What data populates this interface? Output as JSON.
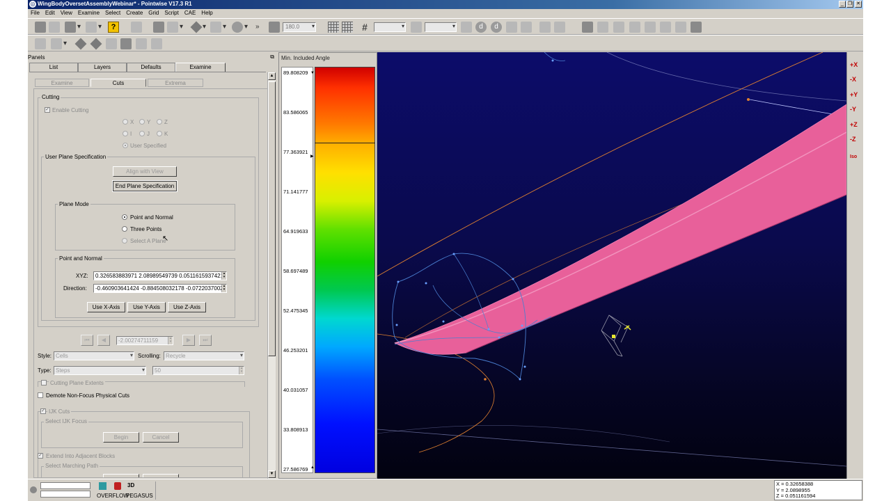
{
  "window": {
    "title": "WingBodyOversetAssemblyWebinar* - Pointwise V17.3 R1",
    "controls": [
      "_",
      "❐",
      "✕"
    ]
  },
  "menu": [
    "File",
    "Edit",
    "View",
    "Examine",
    "Select",
    "Create",
    "Grid",
    "Script",
    "CAE",
    "Help"
  ],
  "toolbar": {
    "angle_value": "180.0",
    "help_icon": "?",
    "more_glyph": "»"
  },
  "panels": {
    "header": "Panels",
    "float_glyph": "⧉",
    "tabs": [
      "List",
      "Layers",
      "Defaults",
      "Examine"
    ],
    "active_tab": "Examine",
    "subtabs": [
      "Examine",
      "Cuts",
      "Extrema"
    ],
    "active_subtab": "Cuts"
  },
  "cutting": {
    "group_title": "Cutting",
    "enable_cutting": "Enable Cutting",
    "axis_radios": [
      "X",
      "Y",
      "Z",
      "I",
      "J",
      "K"
    ],
    "user_specified": "User Specified",
    "user_plane_title": "User Plane Specification",
    "align_with_view": "Align with View",
    "end_plane_spec": "End Plane Specification",
    "plane_mode_title": "Plane Mode",
    "plane_modes": [
      "Point and Normal",
      "Three Points",
      "Select A Plane"
    ],
    "pn_title": "Point and Normal",
    "xyz_label": "XYZ:",
    "xyz_value": "0.326583883971 2.08989549739 0.0511615937421",
    "direction_label": "Direction:",
    "direction_value": "-0.460903641424 -0.884508032178 -0.0722037002",
    "use_x": "Use X-Axis",
    "use_y": "Use Y-Axis",
    "use_z": "Use Z-Axis",
    "nav_value": "-2.00274711159",
    "style_label": "Style:",
    "style_value": "Cells",
    "scrolling_label": "Scrolling:",
    "scrolling_value": "Recycle",
    "type_label": "Type:",
    "type_value": "Steps",
    "steps_value": "50",
    "cutting_plane_extents": "Cutting Plane Extents",
    "demote_label": "Demote Non-Focus Physical Cuts"
  },
  "ijk": {
    "group_title": "IJK Cuts",
    "select_focus_title": "Select IJK Focus",
    "begin": "Begin",
    "cancel": "Cancel",
    "extend_label": "Extend Into Adjacent Blocks",
    "marching_title": "Select Marching Path"
  },
  "colorbar": {
    "title": "Min. Included Angle",
    "ticks": [
      "89.808209",
      "83.586065",
      "77.363921",
      "71.141777",
      "64.919633",
      "58.697489",
      "52.475345",
      "46.253201",
      "40.031057",
      "33.808913",
      "27.586769"
    ],
    "marker_value": "77.363921"
  },
  "view_buttons": [
    "+X",
    "-X",
    "+Y",
    "-Y",
    "+Z",
    "-Z",
    "Iso"
  ],
  "statusbar": {
    "solvers": [
      "OVERFLOW",
      "PEGASUS"
    ],
    "solver_3d": "3D",
    "coords": {
      "x": "X = 0.32658388",
      "y": "Y = 2.0898955",
      "z": "Z = 0.051161594"
    }
  },
  "colors": {
    "wing": "#e8609a",
    "curves": "#4a7fd0",
    "path_lines": "#e08030",
    "viewport_bg": "#0a0a4c",
    "view_button": "#c00000"
  }
}
